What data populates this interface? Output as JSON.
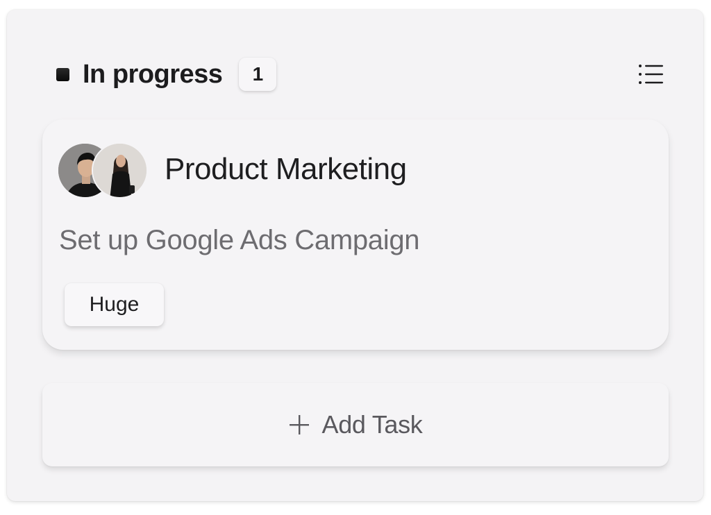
{
  "column": {
    "title": "In progress",
    "count": "1",
    "status_color": "#111111",
    "menu_icon": "list-icon"
  },
  "task": {
    "category": "Product Marketing",
    "title": "Set up Google Ads Campaign",
    "size_tag": "Huge",
    "assignees": [
      {
        "avatar": "man-in-black-shirt-avatar"
      },
      {
        "avatar": "woman-in-black-outfit-avatar"
      }
    ]
  },
  "add_task": {
    "label": "Add Task",
    "icon": "plus-icon"
  }
}
